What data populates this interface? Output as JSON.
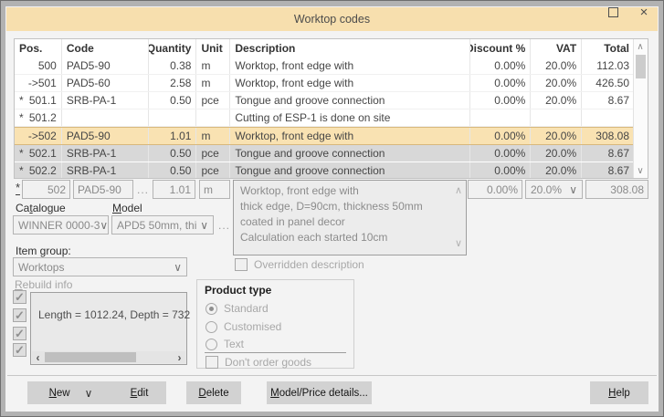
{
  "window": {
    "title": "Worktop codes"
  },
  "colors": {
    "titlebar": "#f7dfae",
    "selected_row_bg": "#f9e2b2",
    "selected_row_border": "#d8b87c",
    "gray_row_bg": "#d8d8d8",
    "button_bg": "#d2d2d2",
    "window_border": "#b2b2b2"
  },
  "table": {
    "headers": {
      "pos": "Pos.",
      "code": "Code",
      "qty": "Quantity",
      "unit": "Unit",
      "desc": "Description",
      "disc": "Discount %",
      "vat": "VAT",
      "total": "Total"
    },
    "rows": [
      {
        "mark": "",
        "num": "500",
        "code": "PAD5-90",
        "qty": "0.38",
        "unit": "m",
        "desc": "Worktop, front edge with",
        "disc": "0.00%",
        "vat": "20.0%",
        "total": "112.03"
      },
      {
        "mark": "",
        "num": "->501",
        "code": "PAD5-60",
        "qty": "2.58",
        "unit": "m",
        "desc": "Worktop, front edge with",
        "disc": "0.00%",
        "vat": "20.0%",
        "total": "426.50"
      },
      {
        "mark": "*",
        "num": "501.1",
        "code": "SRB-PA-1",
        "qty": "0.50",
        "unit": "pce",
        "desc": "Tongue and groove connection",
        "disc": "0.00%",
        "vat": "20.0%",
        "total": "8.67"
      },
      {
        "mark": "*",
        "num": "501.2",
        "code": "",
        "qty": "",
        "unit": "",
        "desc": "Cutting of ESP-1 is done on site",
        "disc": "",
        "vat": "",
        "total": ""
      },
      {
        "mark": "",
        "num": "->502",
        "code": "PAD5-90",
        "qty": "1.01",
        "unit": "m",
        "desc": "Worktop, front edge with",
        "disc": "0.00%",
        "vat": "20.0%",
        "total": "308.08"
      },
      {
        "mark": "*",
        "num": "502.1",
        "code": "SRB-PA-1",
        "qty": "0.50",
        "unit": "pce",
        "desc": "Tongue and groove connection",
        "disc": "0.00%",
        "vat": "20.0%",
        "total": "8.67"
      },
      {
        "mark": "*",
        "num": "502.2",
        "code": "SRB-PA-1",
        "qty": "0.50",
        "unit": "pce",
        "desc": "Tongue and groove connection",
        "disc": "0.00%",
        "vat": "20.0%",
        "total": "8.67"
      }
    ]
  },
  "edit_row": {
    "mark": "*",
    "pos": "502",
    "code": "PAD5-90",
    "browse": "...",
    "qty": "1.01",
    "unit": "m",
    "desc_lines": [
      "Worktop, front edge with",
      "thick edge, D=90cm, thickness 50mm",
      "coated in panel decor",
      "Calculation each started 10cm"
    ],
    "disc": "0.00%",
    "vat": "20.0%",
    "total": "308.08"
  },
  "catalogue": {
    "label_pre": "Ca",
    "label_key": "t",
    "label_post": "alogue",
    "value": "WINNER 0000-3"
  },
  "model": {
    "label_pre": "",
    "label_key": "M",
    "label_post": "odel",
    "value": "APD5 50mm, thi",
    "browse": "..."
  },
  "item_group": {
    "label_pre": "Item ",
    "label_key": "g",
    "label_post": "roup:",
    "value": "Worktops"
  },
  "overridden": {
    "label": "Overridden description",
    "checked": false
  },
  "rebuild": {
    "label_pre": "",
    "label_key": "R",
    "label_post": "ebuild info",
    "info": "Length = 1012.24, Depth = 732",
    "checks": [
      true,
      true,
      true,
      true
    ]
  },
  "product_type": {
    "title": "Product type",
    "options": [
      "Standard",
      "Customised",
      "Text"
    ],
    "selected": "Standard",
    "dont_order_label": "Don't order goods",
    "dont_order_checked": false
  },
  "buttons": {
    "new": {
      "pre": "",
      "key": "N",
      "post": "ew"
    },
    "edit": {
      "pre": "",
      "key": "E",
      "post": "dit"
    },
    "delete": {
      "pre": "",
      "key": "D",
      "post": "elete"
    },
    "model_price": {
      "pre": "",
      "key": "M",
      "post": "odel/Price details..."
    },
    "help": {
      "pre": "",
      "key": "H",
      "post": "elp"
    }
  }
}
